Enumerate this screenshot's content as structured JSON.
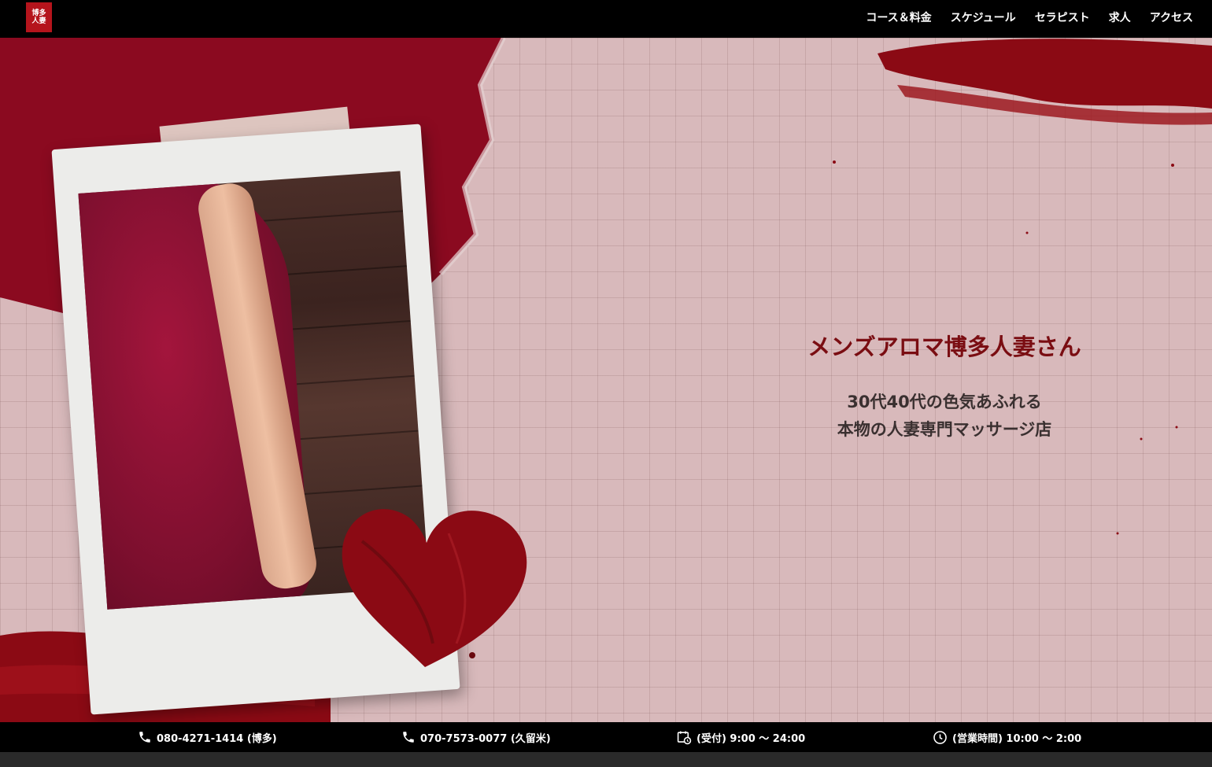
{
  "logo": {
    "lines": [
      "博多",
      "人妻"
    ]
  },
  "nav": [
    {
      "label": "コース＆料金"
    },
    {
      "label": "スケジュール"
    },
    {
      "label": "セラピスト"
    },
    {
      "label": "求人"
    },
    {
      "label": "アクセス"
    }
  ],
  "hero": {
    "title": "メンズアロマ博多人妻さん",
    "tagline_line1": "30代40代の色気あふれる",
    "tagline_line2": "本物の人妻専門マッサージ店"
  },
  "info": {
    "phone1": "080-4271-1414 (博多)",
    "phone2": "070-7573-0077 (久留米)",
    "reception": "(受付) 9:00 〜 24:00",
    "hours": "(営業時間) 10:00 〜 2:00"
  },
  "icons": {
    "phone": "phone-icon",
    "calendar": "calendar-clock-icon",
    "clock": "clock-icon"
  },
  "colors": {
    "accent": "#7a0d12",
    "paint": "#8b0a14",
    "background": "#d8b9bb",
    "bar": "#000000"
  }
}
